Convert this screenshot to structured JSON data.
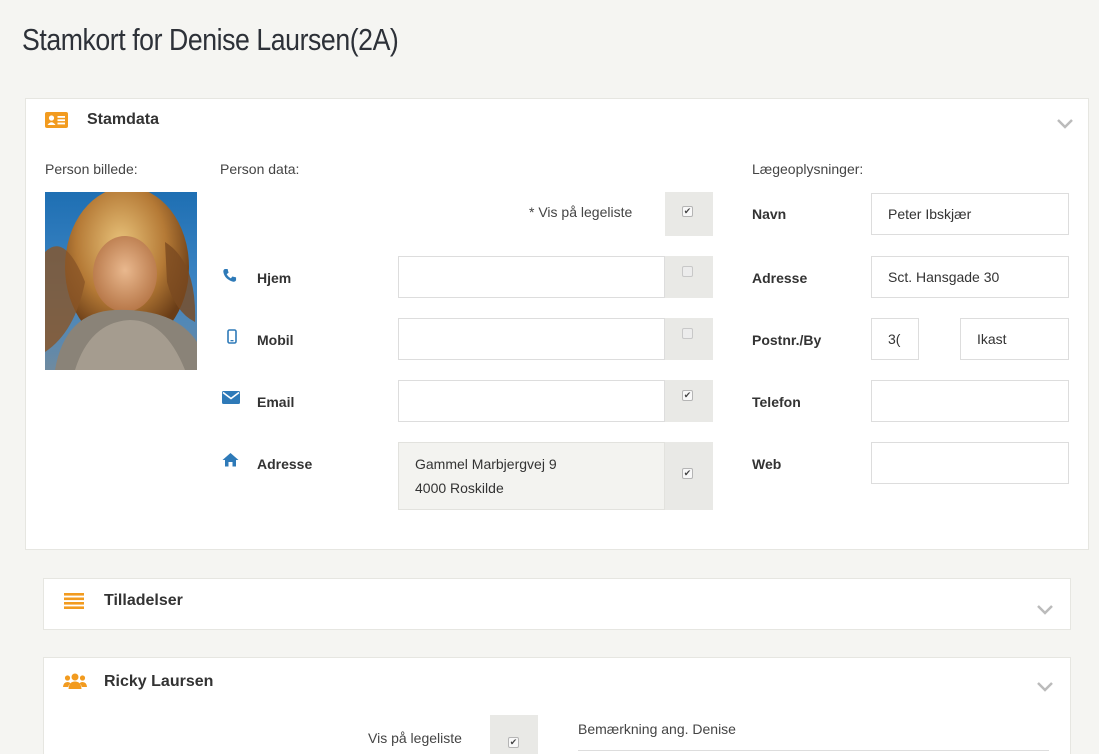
{
  "page": {
    "title": "Stamkort for Denise Laursen(2A)"
  },
  "stamdata": {
    "title": "Stamdata",
    "icon": "id-card-icon",
    "person_billede_label": "Person billede:",
    "person_data_label": "Person data:",
    "vis_paa_legeliste_label": "* Vis på legeliste",
    "vis_paa_legeliste_checked": true,
    "fields": {
      "hjem": {
        "label": "Hjem",
        "icon": "phone-icon",
        "value": "",
        "checked": false
      },
      "mobil": {
        "label": "Mobil",
        "icon": "mobile-icon",
        "value": "",
        "checked": false
      },
      "email": {
        "label": "Email",
        "icon": "envelope-icon",
        "value": "",
        "checked": true
      },
      "adresse": {
        "label": "Adresse",
        "icon": "home-icon",
        "line1": "Gammel Marbjergvej 9",
        "line2": "4000 Roskilde",
        "checked": true
      }
    },
    "laege": {
      "heading": "Lægeoplysninger:",
      "navn_label": "Navn",
      "navn_value": "Peter Ibskjær",
      "adresse_label": "Adresse",
      "adresse_value": "Sct. Hansgade 30",
      "postnr_by_label": "Postnr./By",
      "postnr_value": "3(",
      "by_value": "Ikast",
      "telefon_label": "Telefon",
      "telefon_value": "",
      "web_label": "Web",
      "web_value": ""
    }
  },
  "tilladelser": {
    "title": "Tilladelser",
    "icon": "list-icon"
  },
  "parent": {
    "title": "Ricky Laursen",
    "icon": "users-icon",
    "vis_paa_legeliste_label": "Vis på legeliste",
    "vis_paa_legeliste_checked": true,
    "bemaerkning_label": "Bemærkning ang. Denise"
  },
  "colors": {
    "accent": "#f29b1f",
    "background": "#f5f5f2",
    "panel": "#ffffff"
  }
}
